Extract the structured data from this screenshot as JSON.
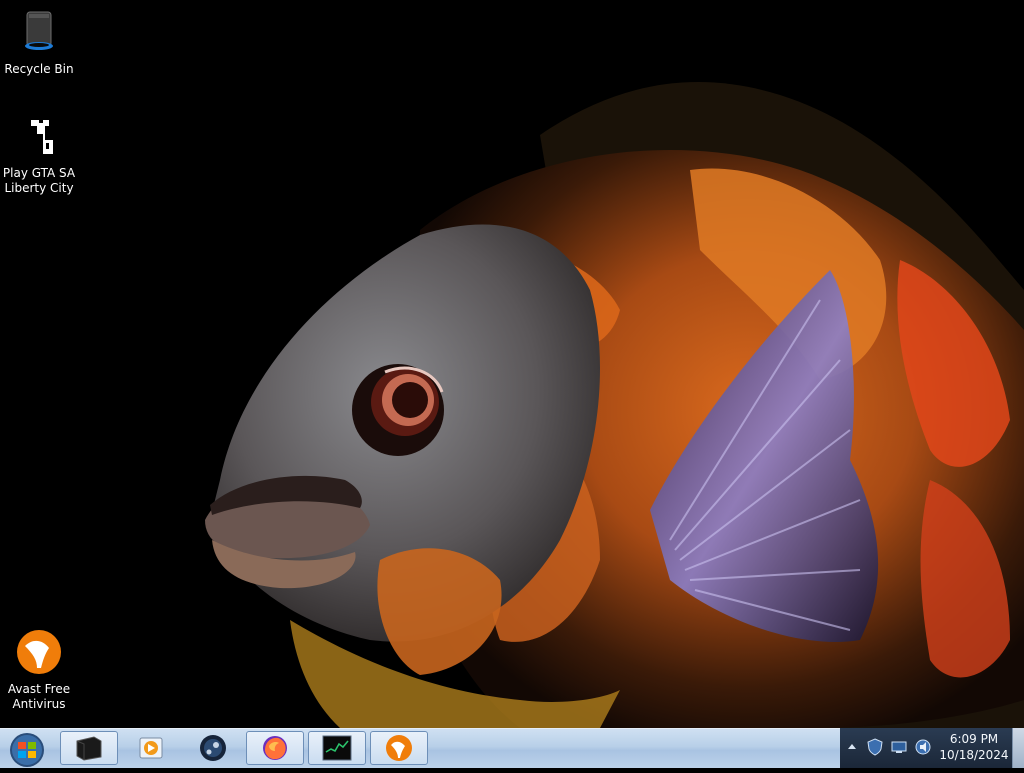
{
  "desktop": {
    "wallpaper": "orange-black oscar fish on black background",
    "icons": [
      {
        "label": "Recycle Bin",
        "icon": "recycle-bin-icon"
      },
      {
        "label": "Play GTA SA Liberty City",
        "icon": "gta-icon"
      },
      {
        "label": "Avast Free Antivirus",
        "icon": "avast-icon"
      }
    ]
  },
  "taskbar": {
    "start": {
      "icon": "windows-start-orb-icon"
    },
    "pinned": [
      {
        "name": "tablet-app",
        "icon": "black-tablet-icon",
        "active": true
      },
      {
        "name": "media-player",
        "icon": "media-player-icon",
        "active": false
      },
      {
        "name": "steam",
        "icon": "steam-icon",
        "active": false
      },
      {
        "name": "firefox",
        "icon": "firefox-icon",
        "active": true
      },
      {
        "name": "task-manager",
        "icon": "task-manager-icon",
        "active": true
      },
      {
        "name": "avast",
        "icon": "avast-icon",
        "active": true
      }
    ],
    "tray": {
      "icons": [
        "show-hidden-icon",
        "windows-defender-icon",
        "network-icon",
        "volume-icon"
      ]
    },
    "clock": {
      "time": "6:09 PM",
      "date": "10/18/2024"
    }
  },
  "colors": {
    "taskbar": "#b8cfe8",
    "tray": "#1b2738",
    "avast_orange": "#f07d0a"
  }
}
